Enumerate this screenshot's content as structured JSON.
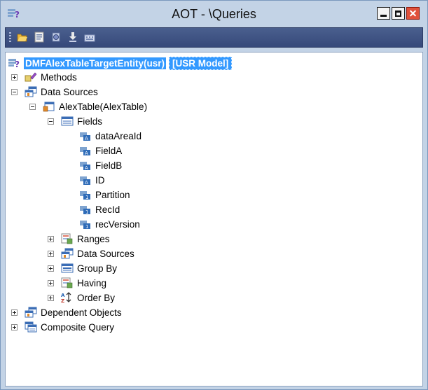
{
  "window": {
    "title": "AOT - \\Queries"
  },
  "toolbar": {
    "buttons": [
      "open-icon",
      "properties-icon",
      "compile-icon",
      "import-icon",
      "save-icon"
    ]
  },
  "tree": {
    "root": {
      "label": "DMFAlexTableTargetEntity(usr)",
      "model": "[USR Model]"
    },
    "methods": "Methods",
    "data_sources": "Data Sources",
    "alex_table": "AlexTable(AlexTable)",
    "fields": "Fields",
    "field_items": [
      "dataAreaId",
      "FieldA",
      "FieldB",
      "ID",
      "Partition",
      "RecId",
      "recVersion"
    ],
    "ranges": "Ranges",
    "nested_data_sources": "Data Sources",
    "group_by": "Group By",
    "having": "Having",
    "order_by": "Order By",
    "dependent_objects": "Dependent Objects",
    "composite_query": "Composite Query"
  },
  "colors": {
    "selection": "#3399ff",
    "toolbar": "#3f5485",
    "chrome": "#c3d3e6",
    "close_button": "#e0513b"
  }
}
